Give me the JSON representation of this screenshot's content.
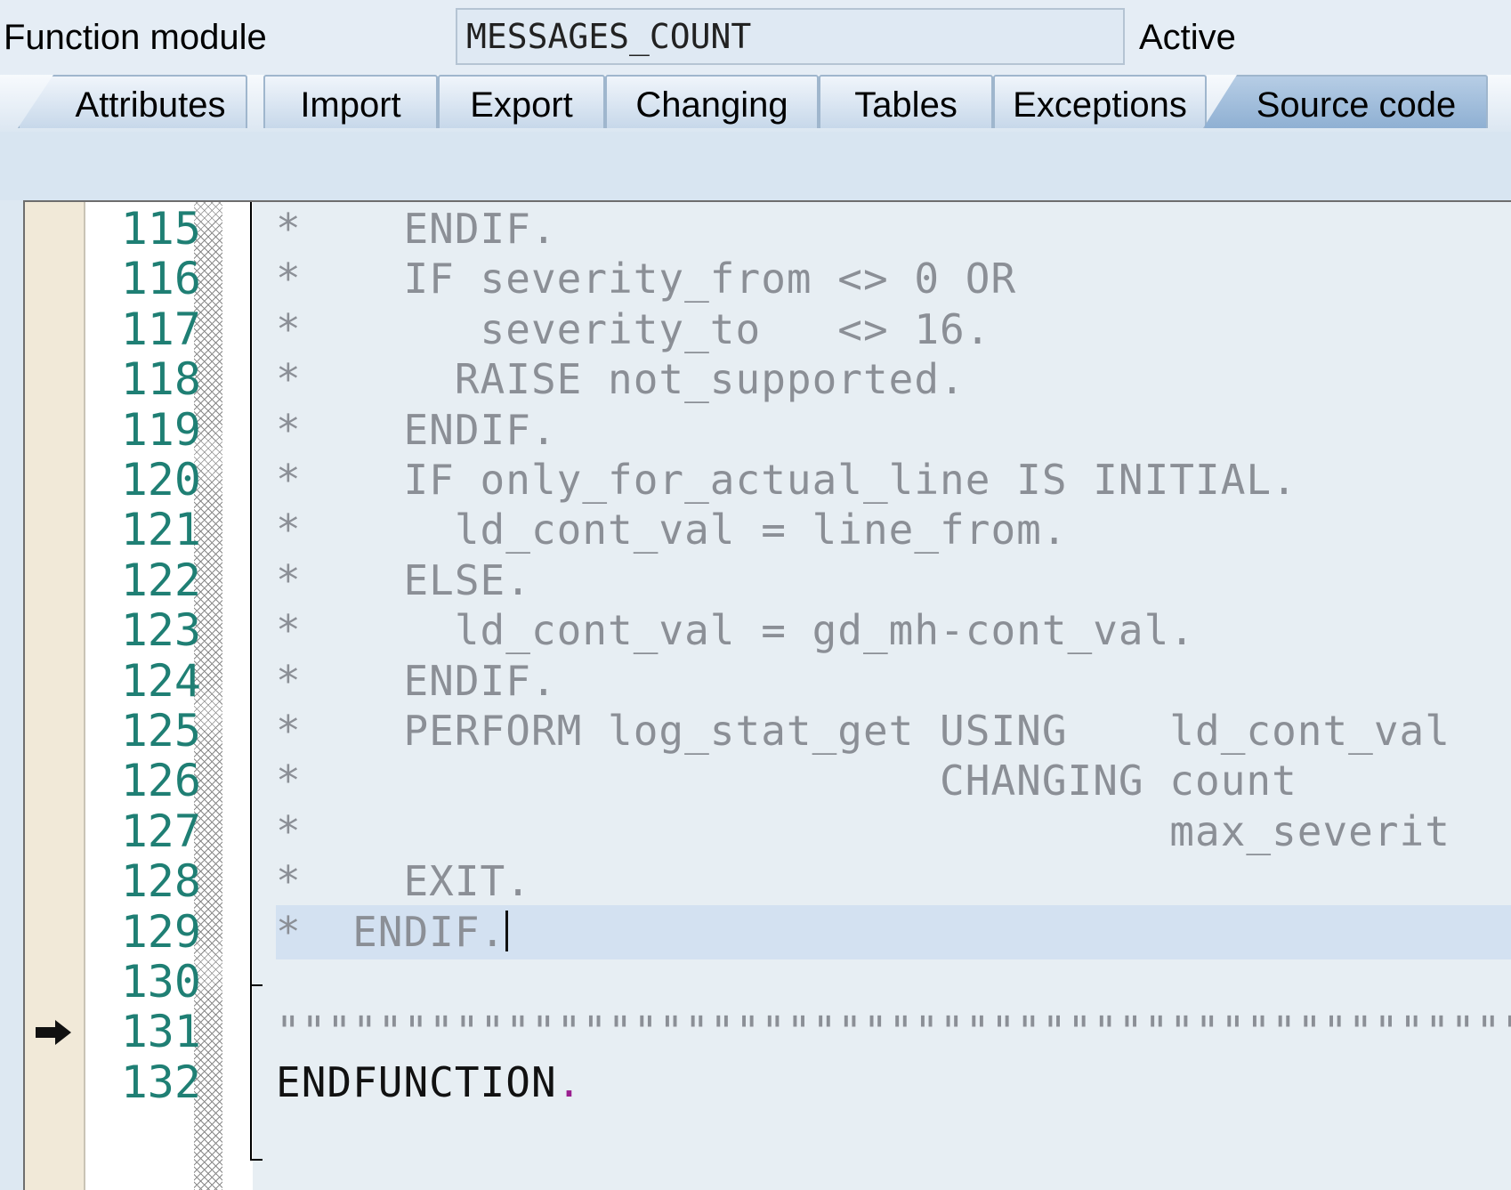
{
  "header": {
    "label": "Function module",
    "name": "MESSAGES_COUNT",
    "status": "Active"
  },
  "tabs": [
    {
      "label": "Attributes"
    },
    {
      "label": "Import"
    },
    {
      "label": "Export"
    },
    {
      "label": "Changing"
    },
    {
      "label": "Tables"
    },
    {
      "label": "Exceptions"
    },
    {
      "label": "Source code",
      "active": true
    }
  ],
  "editor": {
    "current_line": "131",
    "cursor_line": "129",
    "lines": [
      {
        "num": "115",
        "text": "*    ENDIF."
      },
      {
        "num": "116",
        "text": "*    IF severity_from <> 0 OR"
      },
      {
        "num": "117",
        "text": "*       severity_to   <> 16."
      },
      {
        "num": "118",
        "text": "*      RAISE not_supported."
      },
      {
        "num": "119",
        "text": "*    ENDIF."
      },
      {
        "num": "120",
        "text": "*    IF only_for_actual_line IS INITIAL."
      },
      {
        "num": "121",
        "text": "*      ld_cont_val = line_from."
      },
      {
        "num": "122",
        "text": "*    ELSE."
      },
      {
        "num": "123",
        "text": "*      ld_cont_val = gd_mh-cont_val."
      },
      {
        "num": "124",
        "text": "*    ENDIF."
      },
      {
        "num": "125",
        "text": "*    PERFORM log_stat_get USING    ld_cont_val"
      },
      {
        "num": "126",
        "text": "*                         CHANGING count"
      },
      {
        "num": "127",
        "text": "*                                  max_severit"
      },
      {
        "num": "128",
        "text": "*    EXIT."
      },
      {
        "num": "129",
        "text": "*  ENDIF."
      },
      {
        "num": "130",
        "text": ""
      },
      {
        "num": "131",
        "text": "\"\"\"\"\"\"\"\"\"\"\"\"\"\"\"\"\"\"\"\"\"\"\"\"\"\"\"\"\"\"\"\"\"\"\"\"\"\"\"\"\"\"\"\"\"\"\"\"\"\"\"\"\"\"\"\"\"\"\"\"\"\""
      },
      {
        "num": "132",
        "text": "ENDFUNCTION"
      }
    ],
    "last_line_suffix": "."
  }
}
